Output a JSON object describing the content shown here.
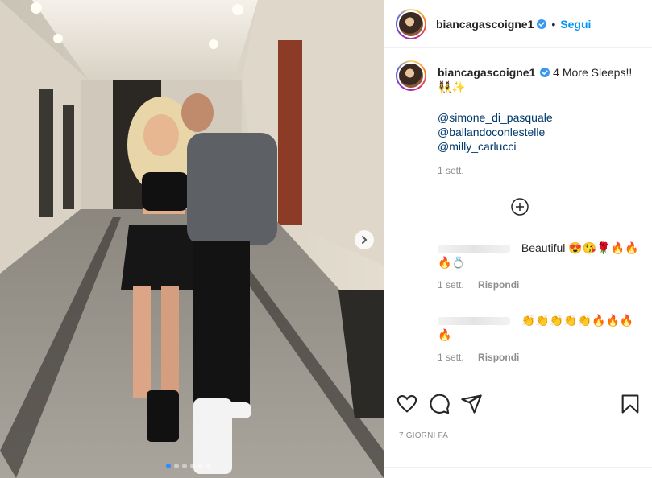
{
  "header": {
    "username": "biancagascoigne1",
    "separator": "•",
    "follow_label": "Segui"
  },
  "caption": {
    "username": "biancagascoigne1",
    "text": "4 More Sleeps!!👯‍♀️✨",
    "mentions": [
      "@simone_di_pasquale",
      "@ballandoconlestelle",
      "@milly_carlucci"
    ],
    "time": "1 sett."
  },
  "comments": [
    {
      "text": "Beautiful 😍😘🌹🔥🔥🔥💍",
      "time": "1 sett.",
      "reply_label": "Rispondi"
    },
    {
      "text": "👏👏👏👏👏🔥🔥🔥🔥",
      "time": "1 sett.",
      "reply_label": "Rispondi"
    }
  ],
  "footer": {
    "date": "7 GIORNI FA"
  },
  "carousel": {
    "total": 6,
    "active": 0
  },
  "colors": {
    "accent": "#0095f6",
    "verified": "#3897f0",
    "active_dot": "#2f8bff"
  }
}
